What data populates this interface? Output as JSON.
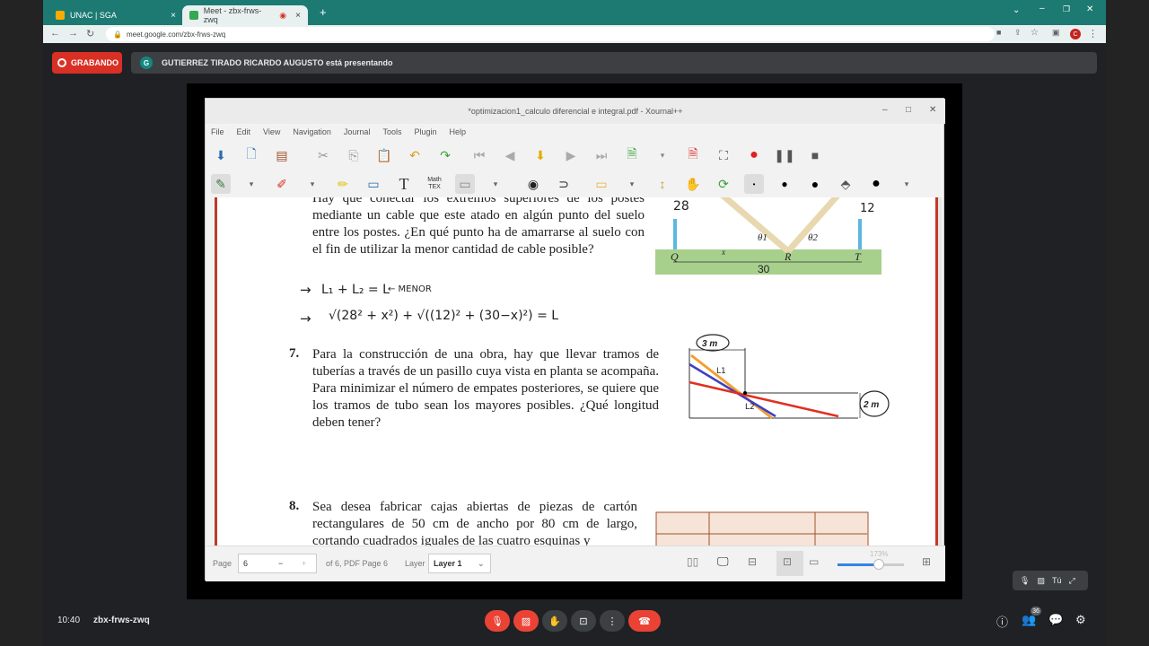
{
  "browser": {
    "tabs": [
      {
        "label": "UNAC | SGA",
        "active": false
      },
      {
        "label": "Meet - zbx-frws-zwq",
        "active": true
      }
    ],
    "url": "meet.google.com/zbx-frws-zwq"
  },
  "meet": {
    "recording_label": "GRABANDO",
    "presenter_initial": "G",
    "presenter_text": "GUTIERREZ TIRADO RICARDO AUGUSTO está presentando",
    "time": "10:40",
    "meeting_code": "zbx-frws-zwq",
    "participants_count": "36",
    "self_label": "Tú"
  },
  "xournal": {
    "title": "*optimizacion1_calculo diferencial e integral.pdf - Xournal++",
    "menu": [
      "File",
      "Edit",
      "View",
      "Navigation",
      "Journal",
      "Tools",
      "Plugin",
      "Help"
    ],
    "status": {
      "page_label": "Page",
      "page_value": "6",
      "page_of": "of 6, PDF Page 6",
      "layer_label": "Layer",
      "layer_value": "Layer 1",
      "zoom": "173%"
    }
  },
  "document": {
    "problem6_text": "Hay que conectar los extremos superiores de los postes mediante un cable que este atado en algún punto del suelo entre los postes. ¿En qué punto ha de amarrarse al suelo con el fin de utilizar la menor cantidad de cable posible?",
    "fig6": {
      "left_height": "28",
      "right_height": "12",
      "theta1": "θ1",
      "theta2": "θ2",
      "p_q": "Q",
      "p_x": "x",
      "p_r": "R",
      "p_t": "T",
      "base": "30"
    },
    "note1_lhs": "L₁ + L₂ = L",
    "note1_rhs": "← MENOR",
    "note2": "√(28² + x²) + √((12)² + (30−x)²) = L",
    "problem7_num": "7.",
    "problem7_text": "Para la construcción de una obra, hay que llevar tramos de tuberías a través de un pasillo cuya vista en planta se acompaña. Para minimizar el número de empates posteriores, se quiere que los tramos de tubo sean los mayores posibles. ¿Qué longitud deben tener?",
    "fig7": {
      "top_width": "3 m",
      "right_width": "2 m",
      "l1": "L1",
      "l2": "L2"
    },
    "problem8_num": "8.",
    "problem8_text": "Sea desea fabricar cajas abiertas de piezas de cartón rectangulares de 50 cm de ancho por 80 cm de largo, cortando cuadrados iguales de las cuatro esquinas y"
  }
}
